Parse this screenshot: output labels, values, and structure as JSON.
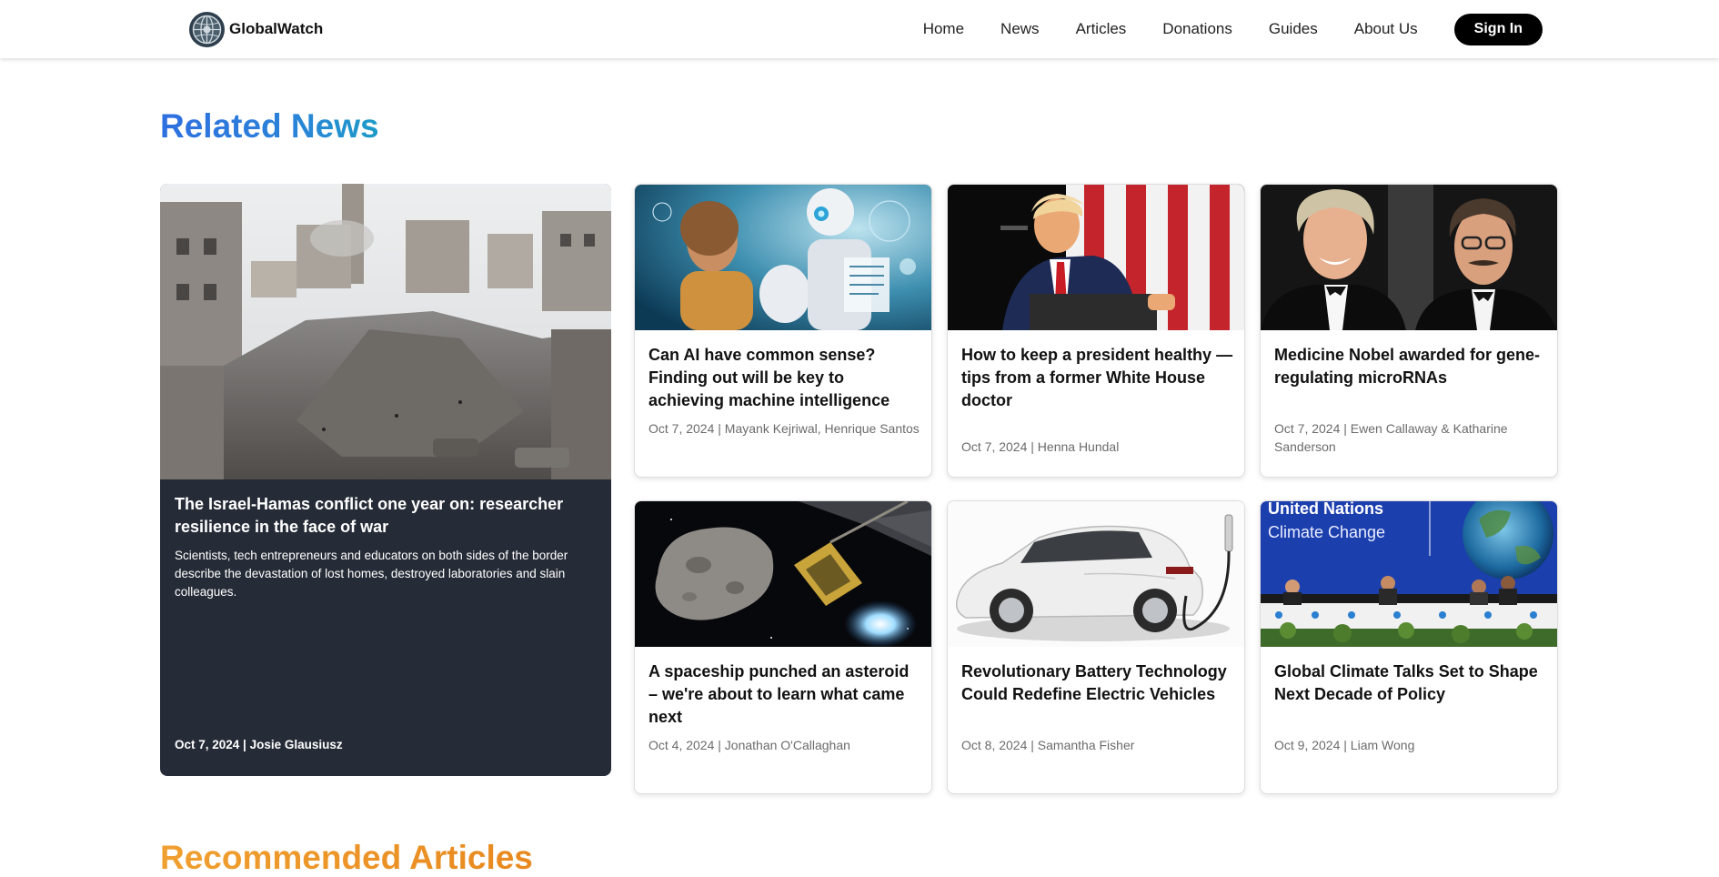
{
  "header": {
    "brand": "GlobalWatch",
    "nav": [
      "Home",
      "News",
      "Articles",
      "Donations",
      "Guides",
      "About Us"
    ],
    "signin": "Sign In"
  },
  "related": {
    "title": "Related News",
    "featured": {
      "title": "The Israel-Hamas conflict one year on: researcher resilience in the face of war",
      "description": "Scientists, tech entrepreneurs and educators on both sides of the border describe the devastation of lost homes, destroyed laboratories and slain colleagues.",
      "meta": "Oct 7, 2024 | Josie Glausiusz"
    },
    "cards": [
      {
        "title": "Can AI have common sense? Finding out will be key to achieving machine intelligence",
        "meta": "Oct 7, 2024 | Mayank Kejriwal, Henrique Santos"
      },
      {
        "title": "How to keep a president healthy — tips from a former White House doctor",
        "meta": "Oct 7, 2024 | Henna Hundal"
      },
      {
        "title": "Medicine Nobel awarded for gene-regulating microRNAs",
        "meta": "Oct 7, 2024 | Ewen Callaway & Katharine Sanderson"
      },
      {
        "title": "A spaceship punched an asteroid – we're about to learn what came next",
        "meta": "Oct 4, 2024 | Jonathan O'Callaghan"
      },
      {
        "title": "Revolutionary Battery Technology Could Redefine Electric Vehicles",
        "meta": "Oct 8, 2024 | Samantha Fisher"
      },
      {
        "title": "Global Climate Talks Set to Shape Next Decade of Policy",
        "meta": "Oct 9, 2024 | Liam Wong"
      }
    ]
  },
  "image_texts": {
    "un_line1": "United Nations",
    "un_line2": "Climate Change"
  },
  "recommended": {
    "title": "Recommended Articles"
  }
}
